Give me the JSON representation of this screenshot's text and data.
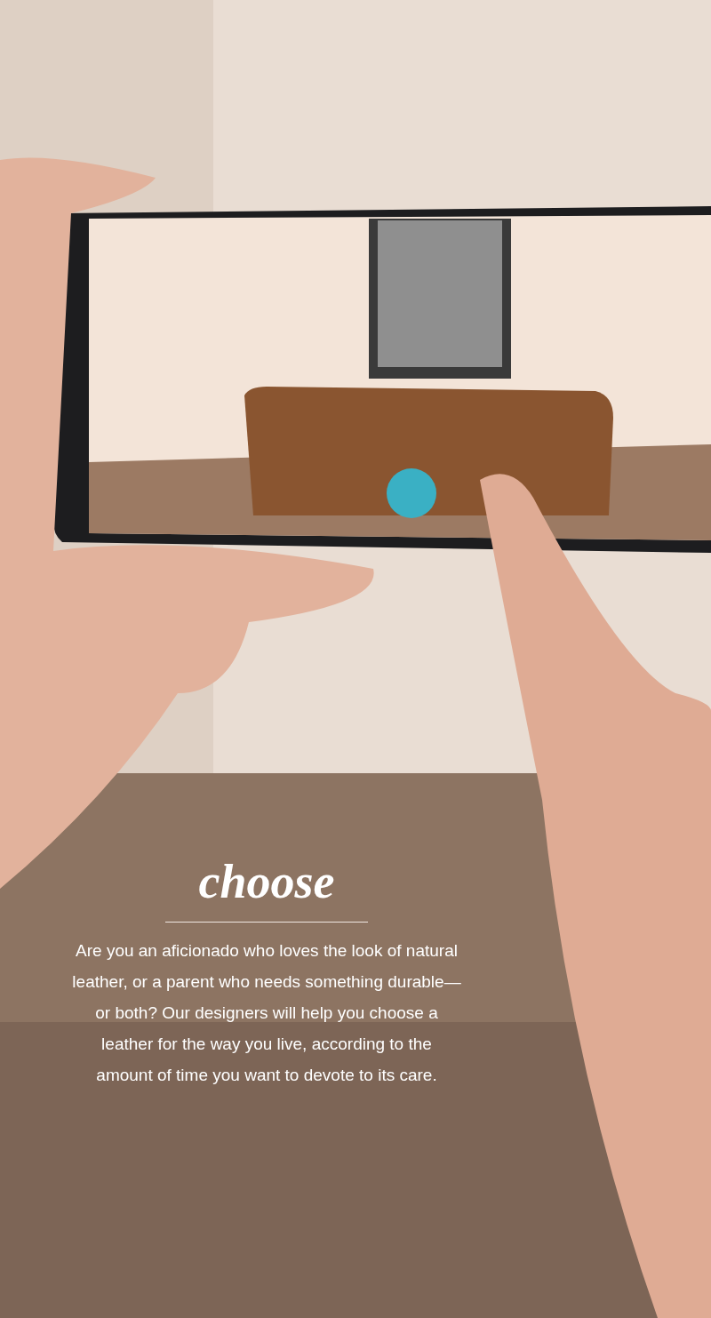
{
  "section": {
    "heading": "choose",
    "body": "Are you an aficionado who loves the look of natural leather, or a parent who needs something durable—or both? Our designers will help you choose a leather for the way you live, according to the amount of time you want to devote to its care."
  }
}
